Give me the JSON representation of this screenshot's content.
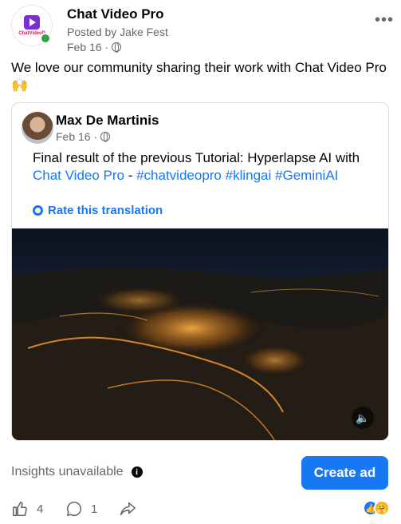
{
  "page": {
    "name": "Chat Video Pro",
    "logo_text": "ChatVideoP",
    "posted_by": "Posted by Jake Fest",
    "date": "Feb 16 ·",
    "more_icon": "more-dots-icon"
  },
  "post": {
    "text": "We love our community sharing their work with Chat Video Pro🙌"
  },
  "shared": {
    "author": "Max De Martinis",
    "date": "Feb 16 ·",
    "text_part1": "Final result of the previous Tutorial: Hyperlapse AI with ",
    "mention": "Chat Video Pro",
    "text_part2": " - ",
    "tag1": "#chatvideopro",
    "tag2": "#klingai",
    "tag3": "#GeminiAI",
    "translate": "Rate this translation"
  },
  "footer": {
    "insights": "Insights unavailable",
    "create_ad": "Create ad",
    "likes": "4",
    "comments": "1"
  },
  "colors": {
    "accent": "#1877f2",
    "text_secondary": "#65676b",
    "online": "#31a24c"
  }
}
